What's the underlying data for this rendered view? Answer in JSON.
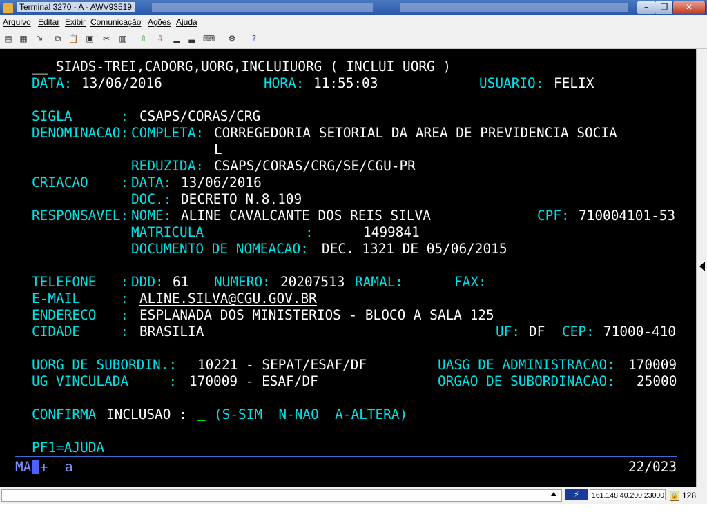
{
  "window": {
    "title": "Terminal 3270 - A - AWV93519",
    "minimize": "–",
    "maximize": "❐",
    "close": "✕"
  },
  "menu": [
    "Arquivo",
    "Editar",
    "Exibir",
    "Comunicação",
    "Ações",
    "Ajuda"
  ],
  "terminal": {
    "header_prefix": "__",
    "header_title": "SIADS-TREI,CADORG,UORG,INCLUIUORG ( INCLUI UORG )",
    "data_label": "DATA:",
    "data_value": "13/06/2016",
    "hora_label": "HORA:",
    "hora_value": "11:55:03",
    "usuario_label": "USUARIO:",
    "usuario_value": "FELIX",
    "sigla_label": "SIGLA      :",
    "sigla_value": "CSAPS/CORAS/CRG",
    "denominacao_label": "DENOMINACAO:",
    "completa_label": "COMPLETA:",
    "completa_value_1": "CORREGEDORIA SETORIAL DA AREA DE PREVIDENCIA SOCIA",
    "completa_value_2": "L",
    "reduzida_label": "REDUZIDA:",
    "reduzida_value": "CSAPS/CORAS/CRG/SE/CGU-PR",
    "criacao_label": "CRIACAO    :",
    "criacao_data_label": "DATA:",
    "criacao_data_value": "13/06/2016",
    "doc_label": "DOC.:",
    "doc_value": "DECRETO N.8.109",
    "responsavel_label": "RESPONSAVEL:",
    "nome_label": "NOME:",
    "nome_value": "ALINE CAVALCANTE DOS REIS SILVA",
    "cpf_label": "CPF:",
    "cpf_value": "710004101-53",
    "matricula_label": "MATRICULA",
    "matricula_sep": ":",
    "matricula_value": "1499841",
    "doc_nomeacao_label": "DOCUMENTO DE NOMEACAO:",
    "doc_nomeacao_value": "DEC. 1321 DE 05/06/2015",
    "telefone_label": "TELEFONE   :",
    "ddd_label": "DDD:",
    "ddd_value": "61",
    "numero_label": "NUMERO:",
    "numero_value": "20207513",
    "ramal_label": "RAMAL:",
    "fax_label": "FAX:",
    "email_label": "E-MAIL     :",
    "email_value": "ALINE.SILVA@CGU.GOV.BR",
    "endereco_label": "ENDERECO   :",
    "endereco_value": "ESPLANADA DOS MINISTERIOS - BLOCO A SALA 125",
    "cidade_label": "CIDADE     :",
    "cidade_value": "BRASILIA",
    "uf_label": "UF:",
    "uf_value": "DF",
    "cep_label": "CEP:",
    "cep_value": "71000-410",
    "uorg_sub_label": "UORG DE SUBORDIN.:",
    "uorg_sub_value": "10221 - SEPAT/ESAF/DF",
    "uasg_label": "UASG DE ADMINISTRACAO:",
    "uasg_value": "170009",
    "ug_label": "UG VINCULADA     :",
    "ug_value": "170009 - ESAF/DF",
    "orgao_label": "ORGAO DE SUBORDINACAO:",
    "orgao_value": "25000",
    "confirma_label": "CONFIRMA",
    "inclusao_label": "INCLUSAO :",
    "confirma_options": "(S-SIM  N-NAO  A-ALTERA)",
    "pf1": "PF1=AJUDA",
    "oia_mode": "MA",
    "oia_plus": "+",
    "oia_a": "a",
    "cursor_pos": "22/023"
  },
  "status": {
    "host": "161.148.40.200:23000",
    "enc_bits": "128"
  }
}
